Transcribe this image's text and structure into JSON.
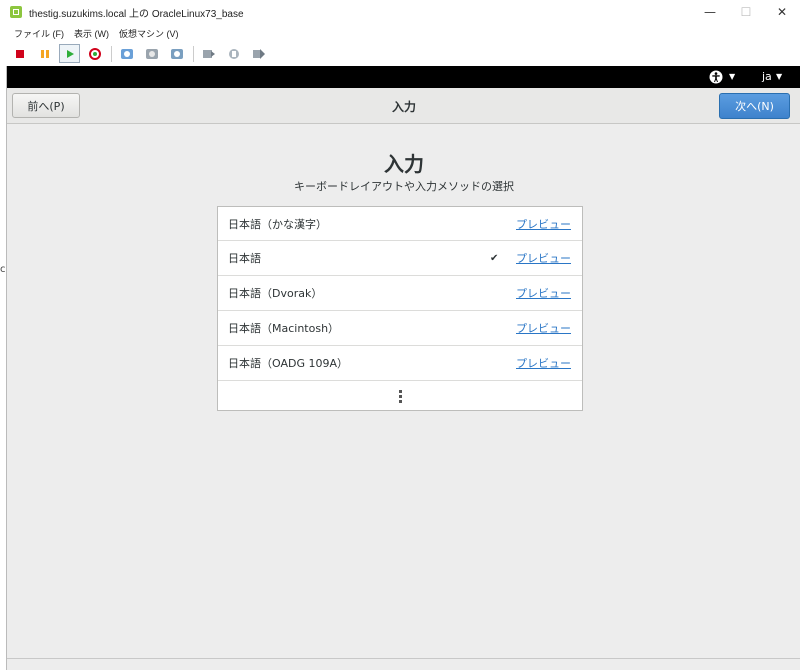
{
  "window": {
    "title": "thestig.suzukims.local 上の OracleLinux73_base",
    "minimize": "—",
    "maximize": "☐",
    "close": "✕"
  },
  "menu": [
    "ファイル (F)",
    "表示 (W)",
    "仮想マシン (V)"
  ],
  "toolbar_icons": [
    "stop-icon",
    "pause-icon",
    "play-icon",
    "reset-icon",
    "snapshot-icon",
    "snapshot-manage-icon",
    "snapshot-revert-icon",
    "send-keys-icon",
    "usb-icon",
    "fullscreen-icon"
  ],
  "gnome_topbar": {
    "caret": "▼",
    "language": "ja"
  },
  "header": {
    "prev_label": "前へ(P)",
    "title": "入力",
    "next_label": "次へ(N)"
  },
  "page": {
    "heading": "入力",
    "subtitle": "キーボードレイアウトや入力メソッドの選択"
  },
  "input_sources": [
    {
      "label": "日本語（かな漢字）",
      "preview": "プレビュー",
      "selected": false
    },
    {
      "label": "日本語",
      "preview": "プレビュー",
      "selected": true,
      "check": "✔"
    },
    {
      "label": "日本語（Dvorak）",
      "preview": "プレビュー",
      "selected": false
    },
    {
      "label": "日本語（Macintosh）",
      "preview": "プレビュー",
      "selected": false
    },
    {
      "label": "日本語（OADG 109A）",
      "preview": "プレビュー",
      "selected": false
    }
  ],
  "left_edge_text": "c",
  "colors": {
    "accent_blue": "#3e82cc",
    "link": "#2a76c6",
    "background": "#ededed"
  }
}
